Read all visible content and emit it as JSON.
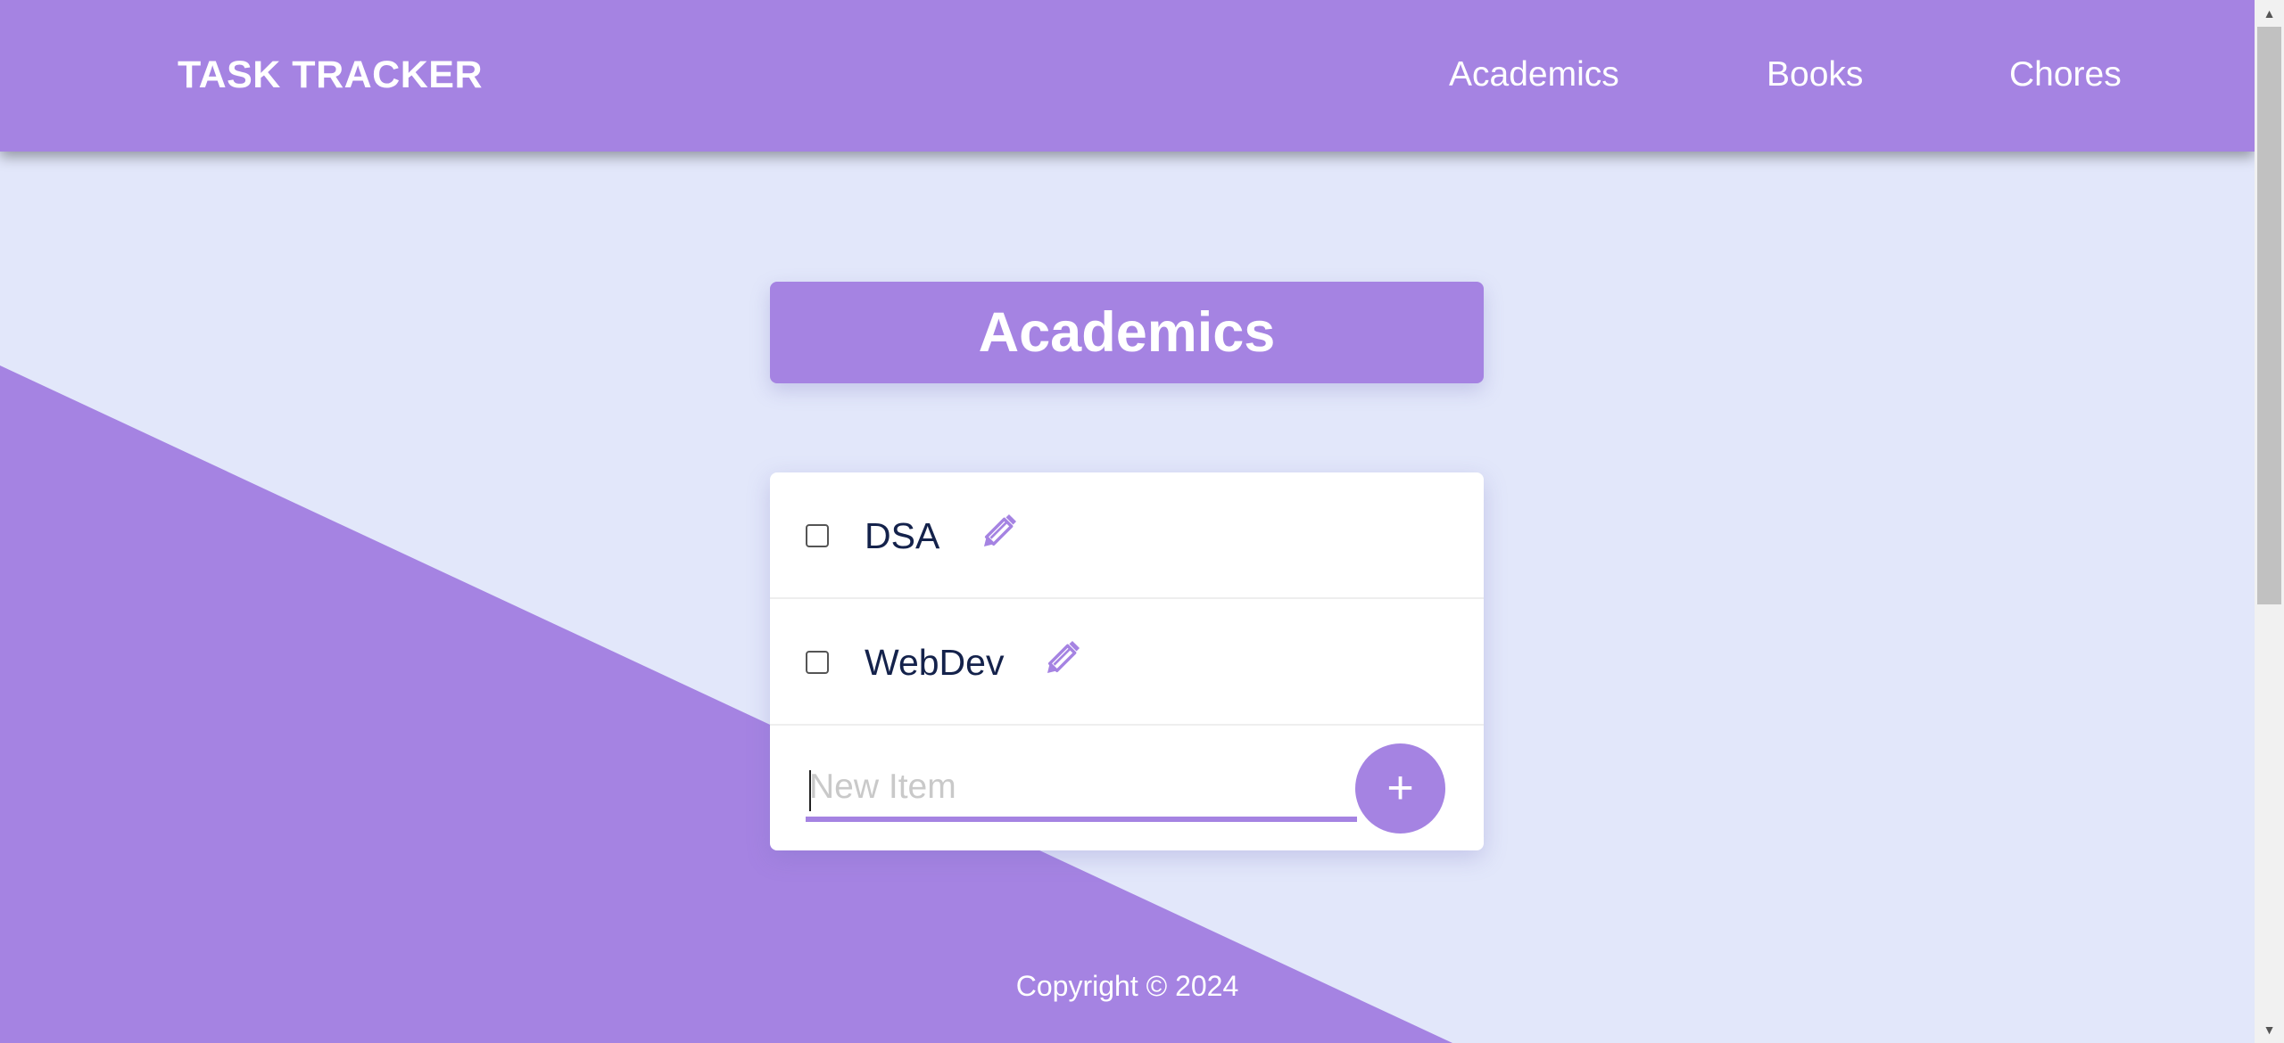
{
  "navbar": {
    "brand": "TASK TRACKER",
    "links": [
      {
        "label": "Academics"
      },
      {
        "label": "Books"
      },
      {
        "label": "Chores"
      }
    ]
  },
  "list": {
    "title": "Academics",
    "items": [
      {
        "label": "DSA",
        "checked": false
      },
      {
        "label": "WebDev",
        "checked": false
      }
    ],
    "new_item": {
      "placeholder": "New Item",
      "value": "",
      "add_label": "+"
    }
  },
  "footer": {
    "text": "Copyright © 2024"
  },
  "icons": {
    "edit": "pencil-icon",
    "add": "plus-icon",
    "scroll_up": "triangle-up-icon",
    "scroll_down": "triangle-down-icon"
  },
  "colors": {
    "accent": "#a583e2",
    "background": "#e2e7fa",
    "text_dark": "#14224b"
  }
}
